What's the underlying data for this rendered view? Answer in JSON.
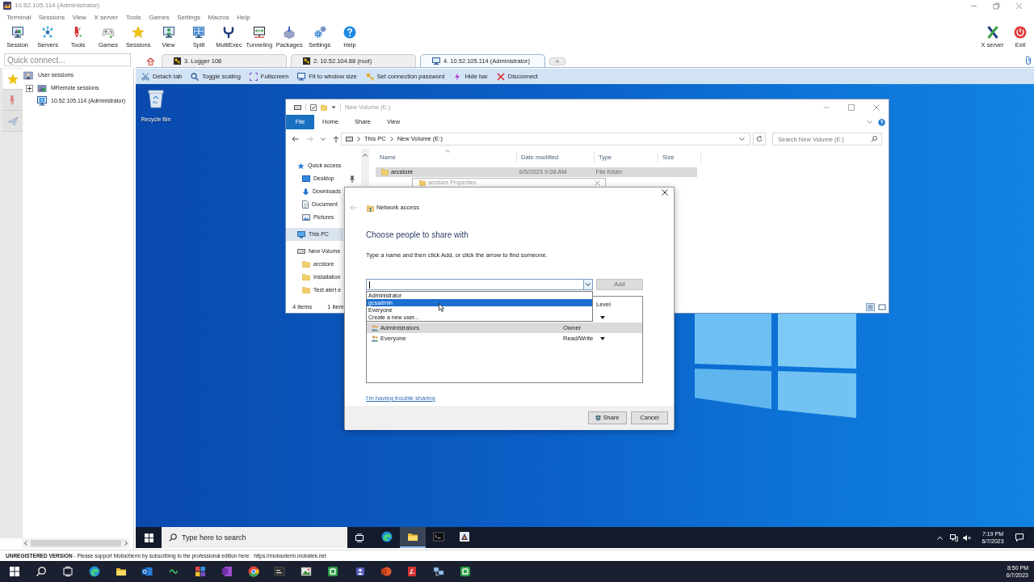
{
  "window": {
    "title": "10.52.105.114 (Administrator)"
  },
  "menu": [
    "Terminal",
    "Sessions",
    "View",
    "X server",
    "Tools",
    "Games",
    "Settings",
    "Macros",
    "Help"
  ],
  "toolbar": [
    "Session",
    "Servers",
    "Tools",
    "Games",
    "Sessions",
    "View",
    "Split",
    "MultiExec",
    "Tunneling",
    "Packages",
    "Settings",
    "Help"
  ],
  "toolbar_right": [
    "X server",
    "Exit"
  ],
  "quick_connect": {
    "placeholder": "Quick connect..."
  },
  "tabs": [
    {
      "label": "3. Logger 108",
      "kind": "terminal",
      "selected": false
    },
    {
      "label": "2. 10.52.104.88 (root)",
      "kind": "terminal",
      "selected": false
    },
    {
      "label": "4. 10.52.105.114 (Administrator)",
      "kind": "desktop",
      "selected": true
    }
  ],
  "sidebar": {
    "tabs": [
      {
        "selected": true
      },
      {
        "selected": false
      },
      {
        "selected": false
      }
    ],
    "tree": [
      {
        "label": "User sessions",
        "kind": "users",
        "children": [
          {
            "label": "MRemote sessions",
            "kind": "folder",
            "expanded": false
          },
          {
            "label": "10.52.105.114 (Administrator)",
            "kind": "host"
          }
        ]
      }
    ]
  },
  "remote_toolbar": [
    "Detach tab",
    "Toggle scaling",
    "Fullscreen",
    "Fit to window size",
    "Set connection password",
    "Hide bar",
    "Disconnect"
  ],
  "desktop": {
    "icons": [
      "Recycle Bin"
    ]
  },
  "explorer": {
    "title": "New Volume (E:)",
    "ribbon": [
      {
        "label": "File",
        "kind": "menu"
      },
      {
        "label": "Home",
        "kind": "tab"
      },
      {
        "label": "Share",
        "kind": "tab"
      },
      {
        "label": "View",
        "kind": "tab"
      }
    ],
    "path": [
      "This PC",
      "New Volume (E:)"
    ],
    "search": {
      "placeholder": "Search New Volume (E:)"
    },
    "nav": [
      {
        "label": "Quick access",
        "kind": "star",
        "selected": false,
        "children": [
          {
            "label": "Desktop",
            "kind": "desktop",
            "selected": false,
            "pinned": true
          },
          {
            "label": "Downloads",
            "kind": "download",
            "selected": false
          },
          {
            "label": "Document",
            "kind": "document",
            "selected": false
          },
          {
            "label": "Pictures",
            "kind": "pictures",
            "selected": false
          }
        ]
      },
      {
        "label": "This PC",
        "kind": "pc",
        "selected": true
      },
      {
        "label": "New Volume",
        "kind": "drive",
        "selected": false,
        "children": [
          {
            "label": "arcstore",
            "kind": "folder",
            "selected": false
          },
          {
            "label": "Installation",
            "kind": "folder",
            "selected": false
          },
          {
            "label": "Test alert e",
            "kind": "folder",
            "selected": false
          }
        ]
      }
    ],
    "columns": [
      "Name",
      "Date modified",
      "Type",
      "Size"
    ],
    "rows": [
      {
        "name": "arcstore",
        "date": "6/5/2023 9:08 AM",
        "type": "File folder",
        "selected": true
      }
    ],
    "status": [
      "4 items",
      "1 item"
    ]
  },
  "properties": {
    "title": "arcstore Properties"
  },
  "share_dialog": {
    "section": "Network access",
    "heading": "Choose people to share with",
    "instruction": "Type a name and then click Add, or click the arrow to find someone.",
    "add": {
      "label": "Add",
      "disabled": true
    },
    "suggestions": [
      {
        "label": "Administrator",
        "selected": false
      },
      {
        "label": "gcsadmin",
        "selected": true
      },
      {
        "label": "Everyone",
        "selected": false
      },
      {
        "label": "Create a new user...",
        "selected": false
      }
    ],
    "people": {
      "header": "Level",
      "rows": [
        {
          "kind": "choice"
        },
        {
          "name": "Administrators",
          "level": "Owner",
          "kind": "fixed",
          "selected": true
        },
        {
          "name": "Everyone",
          "level": "Read/Write",
          "kind": "choice",
          "selected": false
        }
      ]
    },
    "link": "I'm having trouble sharing",
    "buttons": [
      {
        "label": "Share",
        "kind": "shield"
      },
      {
        "label": "Cancel",
        "kind": "plain"
      }
    ]
  },
  "remote_taskbar": {
    "search": {
      "placeholder": "Type here to search"
    },
    "apps": [
      {
        "selected": false
      },
      {
        "selected": true
      },
      {
        "selected": false
      },
      {
        "selected": false
      }
    ],
    "time": "7:19 PM",
    "date": "6/7/2023"
  },
  "status_bar": {
    "text": "**UNREGISTERED VERSION**  -  Please support MobaXterm by subscribing to the professional edition here:",
    "link": "https://mobaxterm.mobatek.net"
  },
  "taskbar": {
    "time": "8:50 PM",
    "date": "6/7/2023"
  }
}
